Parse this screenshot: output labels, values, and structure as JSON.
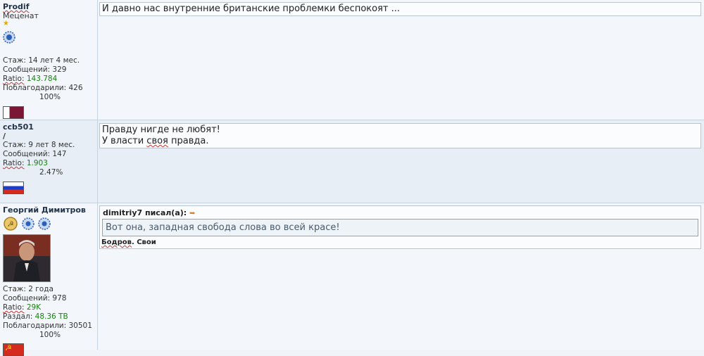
{
  "colors": {
    "green_value": "#17800f",
    "page_bg": "#f0f4f9"
  },
  "posts": [
    {
      "nick": "Prodif",
      "rank": "Меценат",
      "stats": {
        "exp_label": "Стаж:",
        "exp_value": "14 лет 4 мес.",
        "msgs_label": "Сообщений:",
        "msgs_value": "329",
        "ratio_label": "Ratio:",
        "ratio_value": "143.784",
        "thanks_label": "Поблагодарили:",
        "thanks_value": "426",
        "percent": "100%"
      },
      "flag": "qatar-flag",
      "message": "И давно нас внутренние британские проблемки беспокоят ..."
    },
    {
      "nick": "ccb501",
      "rank": "/",
      "stats": {
        "exp_label": "Стаж:",
        "exp_value": "9 лет 8 мес.",
        "msgs_label": "Сообщений:",
        "msgs_value": "147",
        "ratio_label": "Ratio:",
        "ratio_value": "1.903",
        "percent": "2.47%"
      },
      "flag": "russia-flag",
      "message_line1": "Правду нигде не любят!",
      "message_line2_a": "У власти ",
      "message_line2_b": "своя",
      "message_line2_c": " правда."
    },
    {
      "nick": "Георгий Димитров",
      "stats": {
        "exp_label": "Стаж:",
        "exp_value": "2 года",
        "msgs_label": "Сообщений:",
        "msgs_value": "978",
        "ratio_label": "Ratio:",
        "ratio_value": "29K",
        "upload_label": "Раздал:",
        "upload_value": "48.36 TB",
        "thanks_label": "Поблагодарили:",
        "thanks_value": "30501",
        "percent": "100%"
      },
      "flag": "ussr-flag",
      "quote_author": "dimitriy7 писал(а):",
      "quote_text": "Вот она, западная свобода слова во всей красе!",
      "signature_a": "Бодров",
      "signature_b": ". Свои"
    }
  ]
}
